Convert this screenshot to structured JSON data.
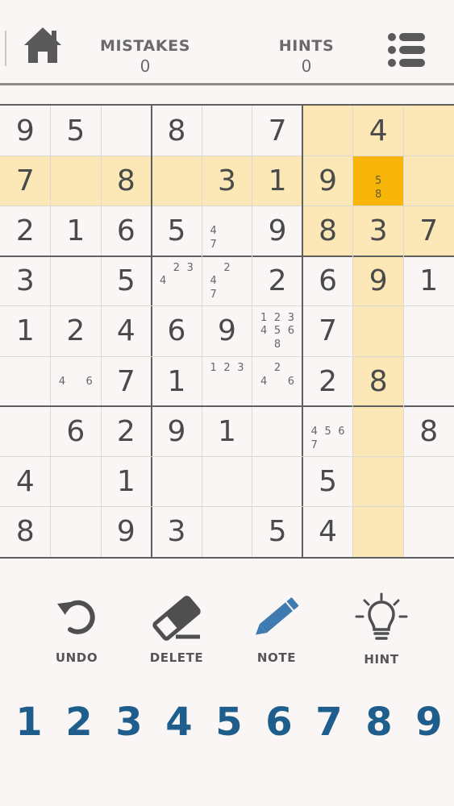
{
  "header": {
    "mistakes_label": "MISTAKES",
    "mistakes_value": "0",
    "hints_label": "HINTS",
    "hints_value": "0",
    "home_icon": "home-icon",
    "menu_icon": "list-menu-icon"
  },
  "board": {
    "selected": [
      1,
      7
    ],
    "highlight_color": "#fbe8b6",
    "selected_color": "#f6b508",
    "cells": [
      [
        {
          "v": "9"
        },
        {
          "v": "5"
        },
        {
          "v": ""
        },
        {
          "v": "8"
        },
        {
          "v": ""
        },
        {
          "v": "7"
        },
        {
          "v": ""
        },
        {
          "v": "4"
        },
        {
          "v": ""
        }
      ],
      [
        {
          "v": "7"
        },
        {
          "v": ""
        },
        {
          "v": "8"
        },
        {
          "v": ""
        },
        {
          "v": "3"
        },
        {
          "v": "1"
        },
        {
          "v": "9"
        },
        {
          "v": "",
          "notes": [
            "5",
            "8"
          ]
        },
        {
          "v": ""
        }
      ],
      [
        {
          "v": "2"
        },
        {
          "v": "1"
        },
        {
          "v": "6"
        },
        {
          "v": "5"
        },
        {
          "v": "",
          "notes": [
            "4",
            "7"
          ]
        },
        {
          "v": "9"
        },
        {
          "v": "8"
        },
        {
          "v": "3"
        },
        {
          "v": "7"
        }
      ],
      [
        {
          "v": "3"
        },
        {
          "v": ""
        },
        {
          "v": "5"
        },
        {
          "v": "",
          "notes": [
            "2",
            "3",
            "4"
          ]
        },
        {
          "v": "",
          "notes": [
            "2",
            "4",
            "7"
          ]
        },
        {
          "v": "2"
        },
        {
          "v": "6"
        },
        {
          "v": "9"
        },
        {
          "v": "1"
        }
      ],
      [
        {
          "v": "1"
        },
        {
          "v": "2"
        },
        {
          "v": "4"
        },
        {
          "v": "6"
        },
        {
          "v": "9"
        },
        {
          "v": "",
          "notes": [
            "1",
            "2",
            "3",
            "4",
            "5",
            "6",
            "8"
          ]
        },
        {
          "v": "7"
        },
        {
          "v": ""
        },
        {
          "v": ""
        }
      ],
      [
        {
          "v": ""
        },
        {
          "v": "",
          "notes": [
            "4",
            "6"
          ]
        },
        {
          "v": "7"
        },
        {
          "v": "1"
        },
        {
          "v": "",
          "notes": [
            "1",
            "2",
            "3"
          ]
        },
        {
          "v": "",
          "notes": [
            "2",
            "4",
            "6"
          ]
        },
        {
          "v": "2"
        },
        {
          "v": "8"
        },
        {
          "v": ""
        }
      ],
      [
        {
          "v": ""
        },
        {
          "v": "6"
        },
        {
          "v": "2"
        },
        {
          "v": "9"
        },
        {
          "v": "1"
        },
        {
          "v": ""
        },
        {
          "v": "",
          "notes": [
            "4",
            "5",
            "6",
            "7"
          ]
        },
        {
          "v": ""
        },
        {
          "v": "8"
        }
      ],
      [
        {
          "v": "4"
        },
        {
          "v": ""
        },
        {
          "v": "1"
        },
        {
          "v": ""
        },
        {
          "v": ""
        },
        {
          "v": ""
        },
        {
          "v": "5"
        },
        {
          "v": ""
        },
        {
          "v": ""
        }
      ],
      [
        {
          "v": "8"
        },
        {
          "v": ""
        },
        {
          "v": "9"
        },
        {
          "v": "3"
        },
        {
          "v": ""
        },
        {
          "v": "5"
        },
        {
          "v": "4"
        },
        {
          "v": ""
        },
        {
          "v": ""
        }
      ]
    ]
  },
  "tools": {
    "undo": {
      "label": "UNDO",
      "icon": "undo-icon"
    },
    "delete": {
      "label": "DELETE",
      "icon": "eraser-icon"
    },
    "note": {
      "label": "NOTE",
      "icon": "pencil-icon"
    },
    "hint": {
      "label": "HINT",
      "icon": "lightbulb-icon"
    }
  },
  "numpad": [
    "1",
    "2",
    "3",
    "4",
    "5",
    "6",
    "7",
    "8",
    "9"
  ],
  "numpad_color": "#1e5d8c"
}
